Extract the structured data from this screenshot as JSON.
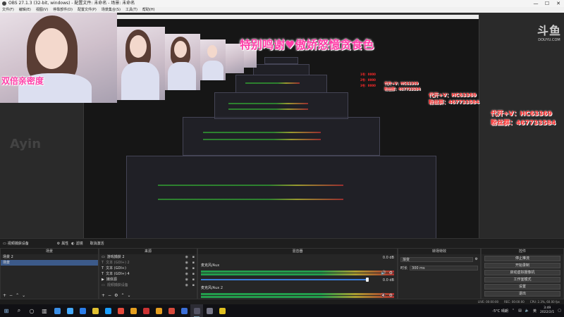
{
  "window": {
    "title": "OBS 27.1.3 (32-bit, windows) - 配置文件: 未命名 - 场景: 未命名",
    "controls": [
      "—",
      "☐",
      "✕"
    ]
  },
  "menu": [
    "文件(F)",
    "编辑(E)",
    "视图(V)",
    "停靠部件(D)",
    "配置文件(P)",
    "场景集合(S)",
    "工具(T)",
    "帮助(H)"
  ],
  "preview": {
    "banner": "特别鸣谢♥傲娇怒憶贪食色",
    "caption_left": "双倍亲密度",
    "promo_line1": "代开+V：HC63369",
    "promo_line2": "粉丝群：467733584",
    "nested_promo_line1": "代开+V：HC63369",
    "nested_promo_line2": "粉丝群：467733584",
    "tiny_promo_line1": "代开+V：HC63369",
    "tiny_promo_line2": "粉丝群：467733584",
    "red_tag_1": "1号：0000",
    "red_tag_2": "2号：0000",
    "red_tag_3": "3号：0000",
    "watermark": "Ayin",
    "douyu_logo": "斗鱼",
    "douyu_url": "DOUYU.COM"
  },
  "dock_header": {
    "source_name": "视频捕获设备",
    "properties": "属性",
    "filters": "滤镜",
    "deactivate": "取消激活"
  },
  "scenes": {
    "title": "场景",
    "items": [
      "场景 2",
      "场景"
    ],
    "selected_index": 1
  },
  "sources": {
    "title": "来源",
    "items": [
      {
        "icon": "▭",
        "label": "游戏捕获 2"
      },
      {
        "icon": "T",
        "label": "文本 (GDI+) 2"
      },
      {
        "icon": "T",
        "label": "文本 (GDI+)"
      },
      {
        "icon": "T",
        "label": "文本 (GDI+) 4"
      },
      {
        "icon": "▶",
        "label": "媒体源"
      },
      {
        "icon": "▭",
        "label": "视频捕获设备"
      }
    ]
  },
  "mixer": {
    "title": "混音器",
    "tracks": [
      {
        "name": "麦克风/Aux",
        "db": "0.0 dB"
      },
      {
        "name": "麦克风/Aux 2",
        "db": "0.0 dB"
      }
    ]
  },
  "transitions": {
    "title": "转场特效",
    "type_value": "渐变",
    "duration_label": "时长",
    "duration_value": "300 ms"
  },
  "controls": {
    "title": "控件",
    "buttons": [
      "停止推流",
      "开始录制",
      "启动虚拟摄像机",
      "工作室模式",
      "设置",
      "退出"
    ]
  },
  "status": {
    "live": "LIVE: 00:00:00",
    "rec": "REC: 00:00:00",
    "cpu": "CPU: 2.3%, 60.00 fps"
  },
  "taskbar": {
    "weather": "-5°C 晴朗",
    "time": "3:49",
    "date": "2022/2/1",
    "lang": "英",
    "app_icon_colors": [
      "#3a8ee6",
      "#44aaff",
      "#2b7de9",
      "#e0c030",
      "#1a9fff",
      "#e64a3b",
      "#e6a020",
      "#cc3333",
      "#e6a020",
      "#d84a3b",
      "#3b6fd8",
      "#555566",
      "#777788",
      "#e0c020"
    ]
  }
}
